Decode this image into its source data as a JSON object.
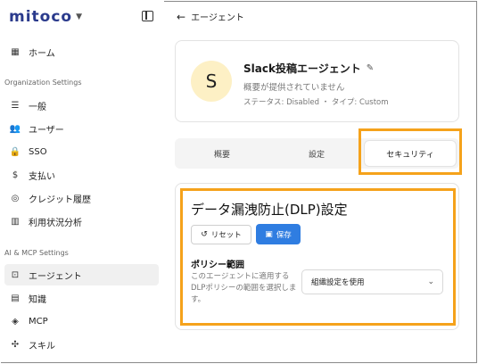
{
  "app": {
    "logo_text": "mitoco"
  },
  "sidebar": {
    "home": {
      "label": "ホーム",
      "icon": "grid-icon"
    },
    "org_section": "Organization Settings",
    "org_items": [
      {
        "label": "一般",
        "icon": "sliders-icon"
      },
      {
        "label": "ユーザー",
        "icon": "users-icon"
      },
      {
        "label": "SSO",
        "icon": "lock-icon"
      },
      {
        "label": "支払い",
        "icon": "dollar-icon"
      },
      {
        "label": "クレジット履歴",
        "icon": "coins-icon"
      },
      {
        "label": "利用状況分析",
        "icon": "bar-chart-icon"
      }
    ],
    "ai_section": "AI & MCP Settings",
    "ai_items": [
      {
        "label": "エージェント",
        "icon": "bot-icon",
        "active": true
      },
      {
        "label": "知識",
        "icon": "book-icon"
      },
      {
        "label": "MCP",
        "icon": "mcp-icon"
      },
      {
        "label": "スキル",
        "icon": "puzzle-icon"
      }
    ]
  },
  "header": {
    "back_label": "エージェント"
  },
  "agent": {
    "avatar_letter": "S",
    "name": "Slack投稿エージェント",
    "description": "概要が提供されていません",
    "status_line": "ステータス: Disabled ・ タイプ: Custom"
  },
  "tabs": [
    {
      "label": "概要"
    },
    {
      "label": "設定"
    },
    {
      "label": "セキュリティ",
      "active": true
    }
  ],
  "dlp": {
    "title": "データ漏洩防止(DLP)設定",
    "reset_label": "リセット",
    "save_label": "保存",
    "policy_label": "ポリシー範囲",
    "policy_desc": "このエージェントに適用するDLPポリシーの範囲を選択します。",
    "policy_value": "組織設定を使用"
  },
  "colors": {
    "accent": "#2f7de1",
    "highlight": "#f5a21b",
    "logo": "#2a3a8c"
  }
}
